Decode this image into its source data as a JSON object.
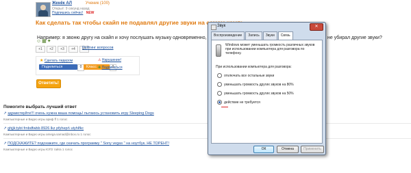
{
  "user": {
    "name": "Женёк АЛ",
    "rank": "Ученик (100)",
    "asked": "Открыт: 9 секунд назад",
    "subscribe": "Подпишись сейчас!",
    "new_badge": "NEW"
  },
  "question": {
    "title": "Как сделать так чтобы скайп не подавлял другие звуки на самом компь",
    "text": "Например: я звоню другу на скайп и хочу послушать музыку одновременно, или я",
    "text_tail": "не убирал другие звуки?"
  },
  "pagination": {
    "pages": [
      "+1",
      "+2",
      "+3",
      "+4",
      "+5"
    ],
    "rate_link": "Рейтинг вопросов"
  },
  "share": {
    "favorite": "Сделать лидером",
    "violation": "Нарушение!",
    "share_label": "Поделиться",
    "share_count": "0",
    "class_label": "Класс",
    "class_count": "0",
    "subscribe_label": "Подписаться"
  },
  "answer_button": "Ответить!",
  "related": {
    "title": "Помогите выбрать лучший ответ",
    "items": [
      {
        "text": "здравствуйте!!! очень нужна ваша помощь! пытаюсь установить игру Sleeping Dogs",
        "meta": "Компьютерные и Видео игры ариф ff 1 голос"
      },
      {
        "text": "ghjjk;tybt frnbdfwbb 8926 lkz pfyhepr\\ utyhlfkc",
        "meta": "Компьютерные и Видео игры amega.samad@inbox.ru 1 голос"
      },
      {
        "text": "ПОДСКАЖИТЕ? подскажите, где скачать программу \" Sony vegas \" на ноутбук. НЕ ТОРЕНТ!",
        "meta": "Компьютерные и Видео игры ЮГО тайга 1 голос"
      }
    ]
  },
  "dialog": {
    "title": "Звук",
    "close_label": "✕",
    "tabs": [
      "Воспроизведение",
      "Запись",
      "Звуки",
      "Связь"
    ],
    "active_tab": 3,
    "description": "Windows может уменьшать громкость различных звуков при использовании компьютера для разговора по телефону.",
    "label": "При использовании компьютера для разговора:",
    "options": [
      "отключать все остальные звуки",
      "уменьшать громкость других звуков на 80%",
      "уменьшать громкость других звуков на 50%",
      "действие не требуется"
    ],
    "selected": 3,
    "buttons": {
      "ok": "ОК",
      "cancel": "Отмена",
      "apply": "Применить"
    }
  },
  "colors": {
    "accent": "#e07a10",
    "link": "#1a4f9c",
    "dialog": "#cfdcec"
  }
}
